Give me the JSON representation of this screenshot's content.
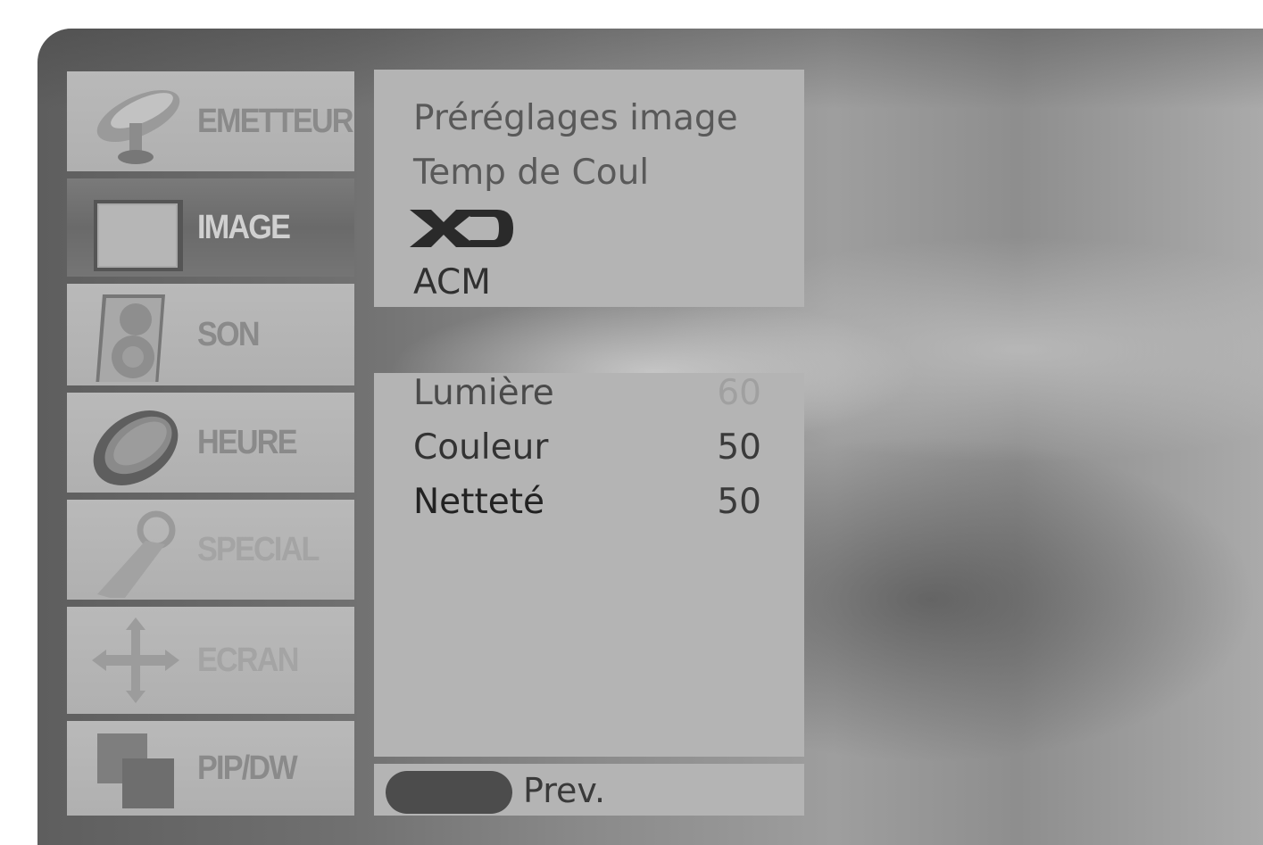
{
  "sidebar": {
    "items": [
      {
        "label": "EMETTEUR",
        "icon": "satellite-dish-icon",
        "state": "normal"
      },
      {
        "label": "IMAGE",
        "icon": "picture-frame-icon",
        "state": "selected"
      },
      {
        "label": "SON",
        "icon": "speaker-icon",
        "state": "normal"
      },
      {
        "label": "HEURE",
        "icon": "clock-ring-icon",
        "state": "normal"
      },
      {
        "label": "SPECIAL",
        "icon": "key-tag-icon",
        "state": "dimmed"
      },
      {
        "label": "ECRAN",
        "icon": "move-arrows-icon",
        "state": "dimmed"
      },
      {
        "label": "PIP/DW",
        "icon": "pip-windows-icon",
        "state": "normal"
      }
    ]
  },
  "menu": {
    "items": [
      "Préréglages image",
      "Temp de Coul",
      "XD",
      "ACM"
    ]
  },
  "settings": {
    "rows": [
      {
        "label": "Lumière",
        "value": "60"
      },
      {
        "label": "Couleur",
        "value": "50"
      },
      {
        "label": "Netteté",
        "value": "50"
      }
    ]
  },
  "footer": {
    "button_color": "#4c4c4c",
    "prev_label": "Prev."
  }
}
